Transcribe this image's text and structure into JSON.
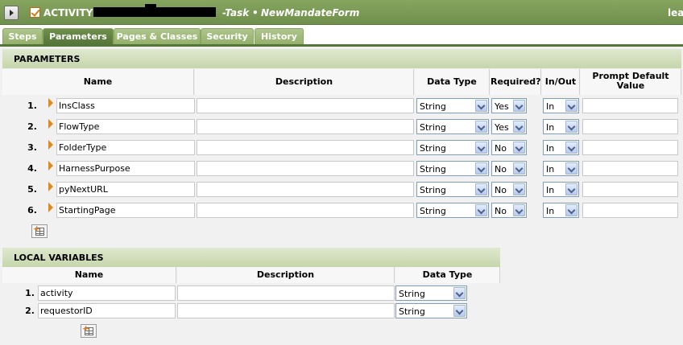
{
  "header": {
    "rule_type": "ACTIVITY",
    "class_suffix": "-Task",
    "bullet": "•",
    "rule_name": "NewMandateForm",
    "right_text": "leave"
  },
  "tabs": [
    {
      "label": "Steps"
    },
    {
      "label": "Parameters",
      "active": true
    },
    {
      "label": "Pages & Classes"
    },
    {
      "label": "Security"
    },
    {
      "label": "History"
    }
  ],
  "parameters": {
    "section_title": "PARAMETERS",
    "columns": {
      "name": "Name",
      "description": "Description",
      "data_type": "Data Type",
      "required": "Required?",
      "in_out": "In/Out",
      "prompt_default": "Prompt Default Value"
    },
    "rows": [
      {
        "num": "1.",
        "name": "InsClass",
        "description": "",
        "data_type": "String",
        "required": "Yes",
        "in_out": "In",
        "prompt_default": ""
      },
      {
        "num": "2.",
        "name": "FlowType",
        "description": "",
        "data_type": "String",
        "required": "Yes",
        "in_out": "In",
        "prompt_default": ""
      },
      {
        "num": "3.",
        "name": "FolderType",
        "description": "",
        "data_type": "String",
        "required": "No",
        "in_out": "In",
        "prompt_default": ""
      },
      {
        "num": "4.",
        "name": "HarnessPurpose",
        "description": "",
        "data_type": "String",
        "required": "No",
        "in_out": "In",
        "prompt_default": ""
      },
      {
        "num": "5.",
        "name": "pyNextURL",
        "description": "",
        "data_type": "String",
        "required": "No",
        "in_out": "In",
        "prompt_default": ""
      },
      {
        "num": "6.",
        "name": "StartingPage",
        "description": "",
        "data_type": "String",
        "required": "No",
        "in_out": "In",
        "prompt_default": ""
      }
    ]
  },
  "local_variables": {
    "section_title": "LOCAL VARIABLES",
    "columns": {
      "name": "Name",
      "description": "Description",
      "data_type": "Data Type"
    },
    "rows": [
      {
        "num": "1.",
        "name": "activity",
        "description": "",
        "data_type": "String"
      },
      {
        "num": "2.",
        "name": "requestorID",
        "description": "",
        "data_type": "String"
      }
    ]
  },
  "colors": {
    "header_bg": "#6f8f4c",
    "tab_bg": "#94b06a",
    "section_bg": "#c6d6ab",
    "arrow": "#e08a1e"
  }
}
